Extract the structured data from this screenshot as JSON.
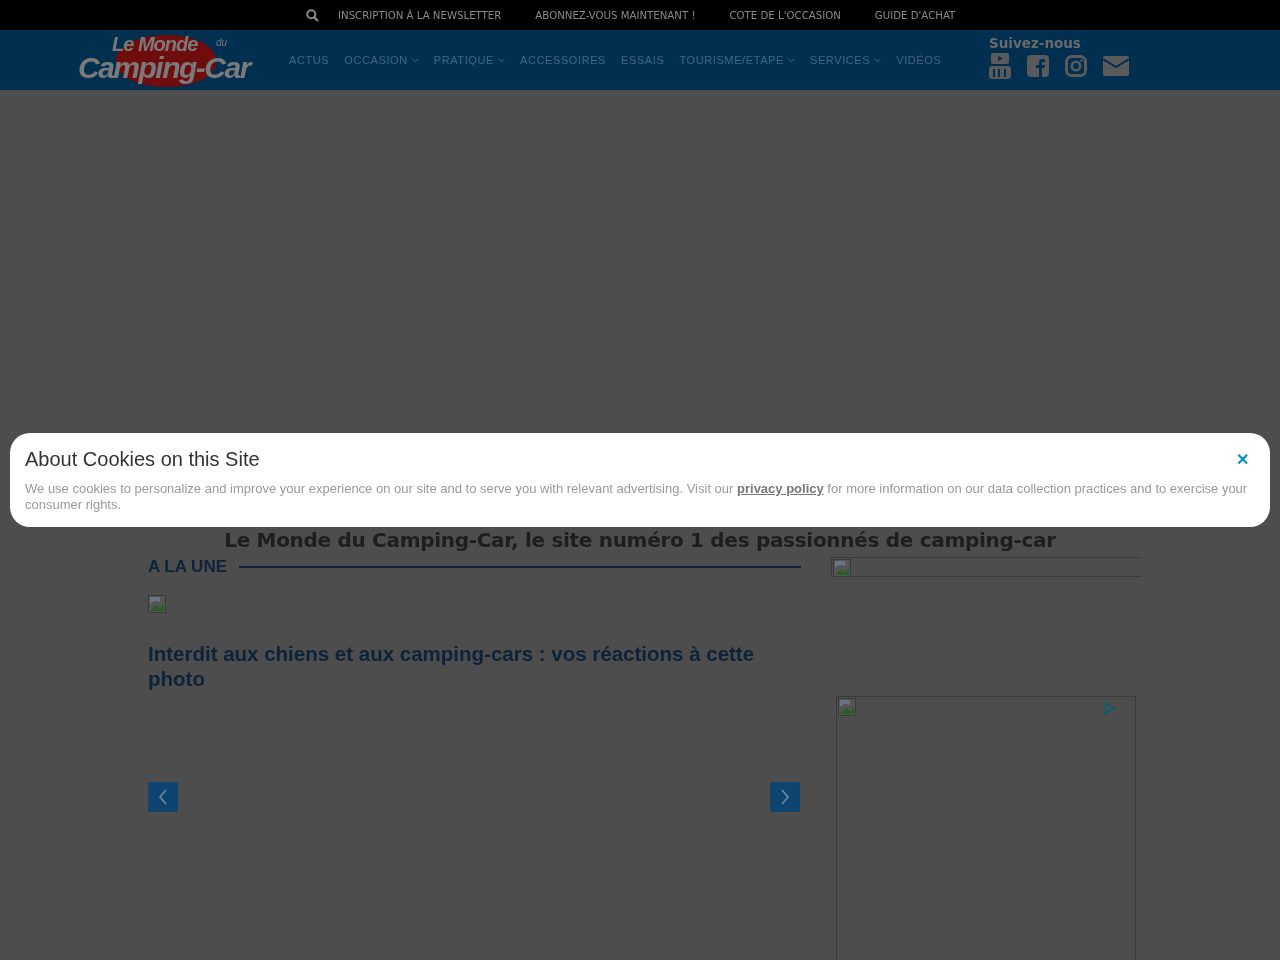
{
  "top_bar": {
    "links": [
      "INSCRIPTION À LA NEWSLETTER",
      "ABONNEZ-VOUS MAINTENANT !",
      "COTE DE L'OCCASION",
      "GUIDE D'ACHAT"
    ]
  },
  "logo": {
    "line_1": "Le Monde",
    "small": "du",
    "line_2": "Camping-Car"
  },
  "nav": {
    "items": [
      {
        "label": "ACTUS",
        "dropdown": false
      },
      {
        "label": "OCCASION",
        "dropdown": true
      },
      {
        "label": "PRATIQUE",
        "dropdown": true
      },
      {
        "label": "ACCESSOIRES",
        "dropdown": false
      },
      {
        "label": "ESSAIS",
        "dropdown": false
      },
      {
        "label": "TOURISME/ETAPE",
        "dropdown": true
      },
      {
        "label": "SERVICES",
        "dropdown": true
      },
      {
        "label": "VIDÉOS",
        "dropdown": false
      }
    ]
  },
  "social": {
    "title": "Suivez-nous",
    "icons": [
      {
        "kind": "youtube"
      },
      {
        "kind": "facebook"
      },
      {
        "kind": "instagram"
      },
      {
        "kind": "mail"
      }
    ]
  },
  "tagline": "Le Monde du Camping-Car, le site numéro 1 des passionnés de camping-car",
  "section": {
    "title": "A LA UNE"
  },
  "article": {
    "title": "Interdit aux chiens et aux camping-cars : vos réactions à cette photo"
  },
  "cookie_banner": {
    "title": "About Cookies on this Site",
    "text_before": "We use cookies to personalize and improve your experience on our site and to serve you with relevant advertising. Visit our",
    "link": "privacy policy",
    "text_after": "for more information on our data collection practices and to exercise your consumer rights.",
    "close": "✕"
  }
}
